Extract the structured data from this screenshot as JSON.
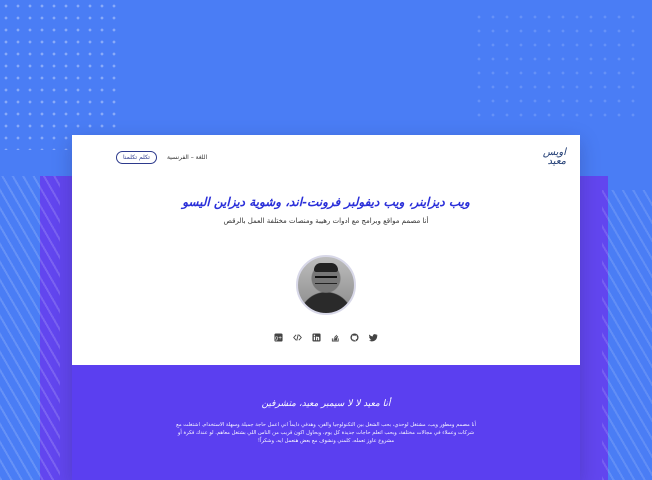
{
  "colors": {
    "background": "#4a7df5",
    "purple": "#6246ef",
    "section_purple": "#5b3ff0",
    "title_blue": "#2a2fd9",
    "button_border": "#2d3a8c"
  },
  "header": {
    "logo_line1": "اويس",
    "logo_line2": "معيد",
    "lang_switch": "اللغة – الفرنسية",
    "contact_label": "تكلم تكلمنا"
  },
  "hero": {
    "title": "ويب ديزاينر، ويب ديفولبر فرونت-اند، وشوية ديزاين اليسو",
    "subtitle": "أنا مصمم مواقع وبرامج مع ادوات رهيبة ومنصات مختلفة العمل بالرقص"
  },
  "social": [
    {
      "name": "twitter-icon",
      "glyph": "twitter"
    },
    {
      "name": "github-icon",
      "glyph": "github"
    },
    {
      "name": "stackoverflow-icon",
      "glyph": "stackoverflow"
    },
    {
      "name": "linkedin-icon",
      "glyph": "linkedin"
    },
    {
      "name": "code-icon",
      "glyph": "code"
    },
    {
      "name": "google-plus-icon",
      "glyph": "google-plus"
    }
  ],
  "about": {
    "title": "أنا معيد لا لا سيمبر معيد، متشرفين",
    "text": "أنا مصمم ومطور ويب، مشتغل لوحدي، بحب الشغل بين التكنولوجيا والفن، وهدفي دايماً اني اعمل حاجة جميلة وسهلة الاستخدام. اشتغلت مع شركات وعملاء في مجالات مختلفة، وبحب اتعلم حاجات جديدة كل يوم، وبحاول اكون قريب من الناس اللي بشتغل معاهم. لو عندك فكرة أو مشروع عاوز تعمله، كلمني ونشوف مع بعض هنعمل ايه. وشكراً!"
  }
}
